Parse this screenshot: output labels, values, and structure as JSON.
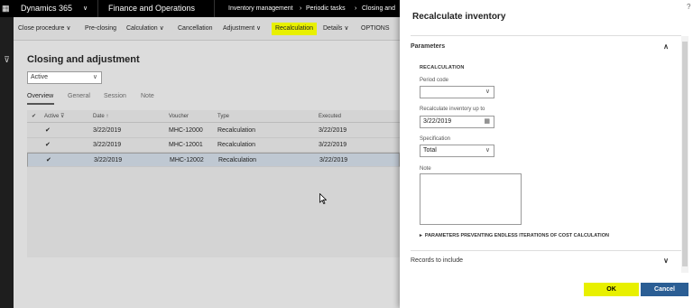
{
  "topbar": {
    "app_name": "Dynamics 365",
    "module": "Finance and Operations",
    "breadcrumb": [
      "Inventory management",
      "Periodic tasks",
      "Closing and"
    ]
  },
  "action_pane": {
    "items": [
      "Close procedure",
      "Pre-closing",
      "Calculation",
      "Cancellation",
      "Adjustment",
      "Recalculation",
      "Details",
      "OPTIONS"
    ]
  },
  "form": {
    "title": "Closing and adjustment",
    "filter_value": "Active",
    "tabs": [
      "Overview",
      "General",
      "Session",
      "Note"
    ],
    "grid": {
      "headers": [
        "Active",
        "Date",
        "Voucher",
        "Type",
        "Executed"
      ],
      "rows": [
        {
          "date": "3/22/2019",
          "voucher": "MHC-12000",
          "type": "Recalculation",
          "executed": "3/22/2019"
        },
        {
          "date": "3/22/2019",
          "voucher": "MHC-12001",
          "type": "Recalculation",
          "executed": "3/22/2019"
        },
        {
          "date": "3/22/2019",
          "voucher": "MHC-12002",
          "type": "Recalculation",
          "executed": "3/22/2019"
        }
      ],
      "selected_row": 2
    }
  },
  "dialog": {
    "help": "?",
    "title": "Recalculate inventory",
    "parameters_header": "Parameters",
    "group_label": "RECALCULATION",
    "period_code_label": "Period code",
    "period_code_value": "",
    "recalc_upto_label": "Recalculate inventory up to",
    "recalc_upto_value": "3/22/2019",
    "specification_label": "Specification",
    "specification_value": "Total",
    "note_label": "Note",
    "sub_section": "PARAMETERS PREVENTING ENDLESS ITERATIONS OF COST CALCULATION",
    "records_header": "Records to include",
    "ok_label": "OK",
    "cancel_label": "Cancel"
  },
  "colors": {
    "highlight": "#e8f000",
    "cancel_button": "#2b5e94",
    "topbar": "#000000"
  }
}
